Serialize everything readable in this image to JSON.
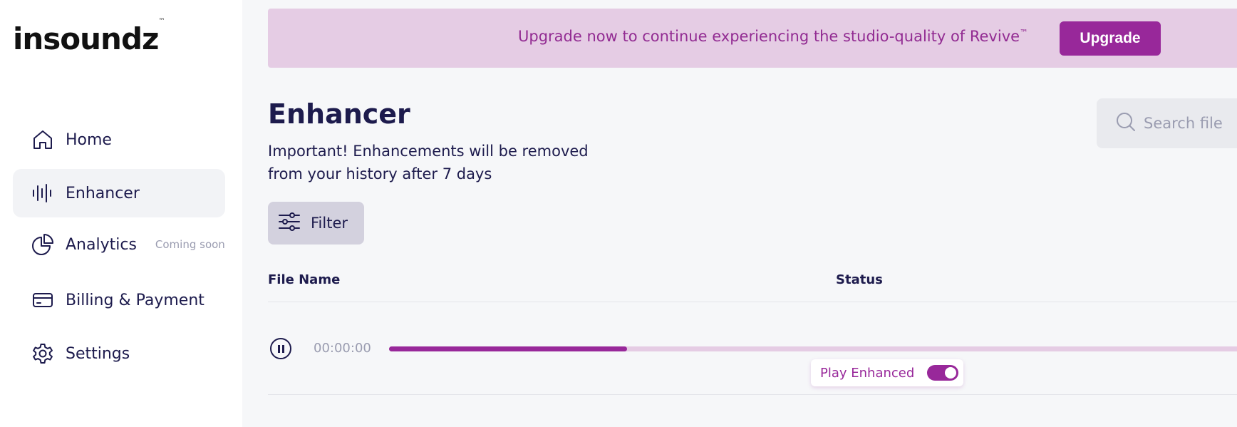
{
  "brand": {
    "name": "insoundz",
    "mark": "™"
  },
  "sidebar": {
    "items": [
      {
        "label": "Home",
        "icon": "home-icon",
        "note": ""
      },
      {
        "label": "Enhancer",
        "icon": "waveform-icon",
        "note": ""
      },
      {
        "label": "Analytics",
        "icon": "pie-chart-icon",
        "note": "Coming soon"
      },
      {
        "label": "Billing & Payment",
        "icon": "credit-card-icon",
        "note": ""
      },
      {
        "label": "Settings",
        "icon": "gear-icon",
        "note": ""
      }
    ],
    "active": "Enhancer"
  },
  "banner": {
    "text": "Upgrade now to continue experiencing the studio-quality of Revive",
    "mark": "™",
    "button": "Upgrade"
  },
  "page": {
    "title": "Enhancer",
    "notice": "Important! Enhancements will be removed from your history after 7 days"
  },
  "search": {
    "placeholder": "Search file",
    "icon": "search-icon"
  },
  "filter": {
    "label": "Filter",
    "icon": "sliders-icon"
  },
  "table": {
    "columns": [
      "File Name",
      "Status"
    ],
    "rows": [
      {
        "time": "00:00:00",
        "progress": 0.276,
        "toggle_label": "Play Enhanced",
        "toggle_on": true
      }
    ]
  },
  "colors": {
    "accent": "#98289a",
    "banner_bg": "#e5cce4",
    "text": "#1d1b4d",
    "muted": "#9a9cb0",
    "page_bg": "#f6f7f9"
  }
}
